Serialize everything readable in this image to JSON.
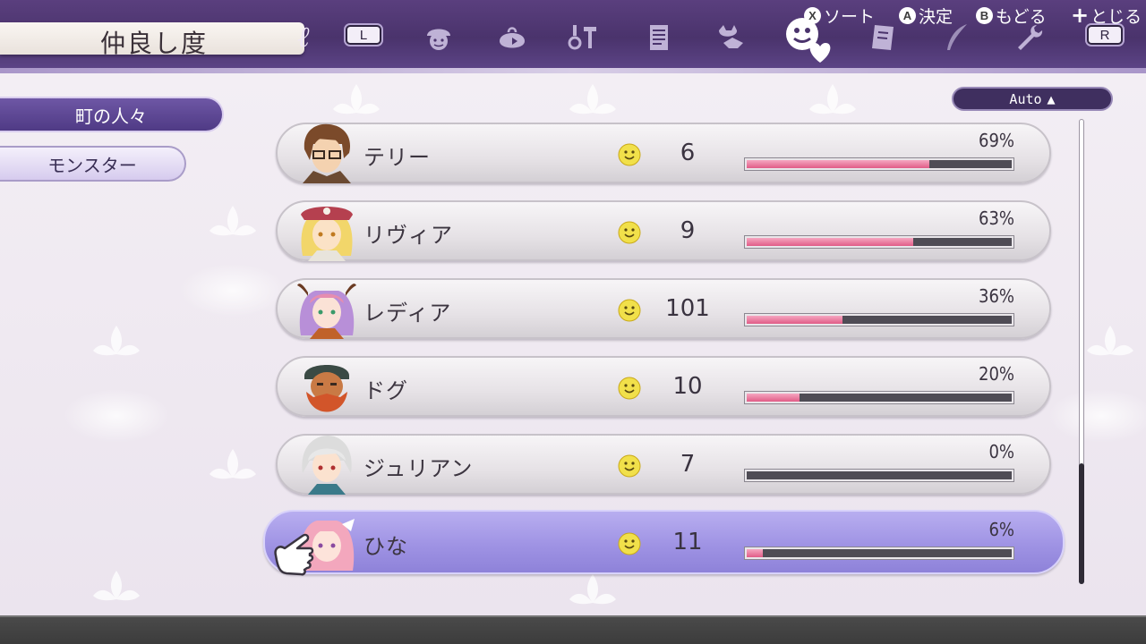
{
  "header": {
    "title": "仲良し度",
    "left_shoulder": "L",
    "right_shoulder": "R",
    "tabs": [
      {
        "icon": "face-cap-icon"
      },
      {
        "icon": "bag-icon"
      },
      {
        "icon": "tools-icon"
      },
      {
        "icon": "document-list-icon"
      },
      {
        "icon": "monster-handshake-icon"
      },
      {
        "icon": "friendship-heart-icon",
        "active": true
      },
      {
        "icon": "book-icon"
      },
      {
        "icon": "quill-icon"
      },
      {
        "icon": "settings-wrench-icon"
      }
    ]
  },
  "categories": {
    "townspeople": "町の人々",
    "monsters": "モンスター"
  },
  "sort": {
    "label": "Auto",
    "arrow": "▲"
  },
  "rows": [
    {
      "name": "テリー",
      "level": "6",
      "percent_text": "69%",
      "percent": 69,
      "portrait": "brown-hair-glasses"
    },
    {
      "name": "リヴィア",
      "level": "9",
      "percent_text": "63%",
      "percent": 63,
      "portrait": "blonde-red-cap"
    },
    {
      "name": "レディア",
      "level": "101",
      "percent_text": "36%",
      "percent": 36,
      "portrait": "purple-hair-horns"
    },
    {
      "name": "ドグ",
      "level": "10",
      "percent_text": "20%",
      "percent": 20,
      "portrait": "orange-beard"
    },
    {
      "name": "ジュリアン",
      "level": "7",
      "percent_text": "0%",
      "percent": 0,
      "portrait": "white-hair"
    },
    {
      "name": "ひな",
      "level": "11",
      "percent_text": "6%",
      "percent": 6,
      "portrait": "pink-hair",
      "selected": true
    }
  ],
  "footer": {
    "sort_btn": "X",
    "sort_label": "ソート",
    "confirm_btn": "A",
    "confirm_label": "決定",
    "back_btn": "B",
    "back_label": "もどる",
    "close_btn": "+",
    "close_label": "とじる"
  },
  "colors": {
    "header": "#4a336c",
    "bar_fill": "#e15c87",
    "bar_track": "#4f4c55",
    "selected_row": "#9f93e4",
    "category_active": "#5a4590"
  }
}
